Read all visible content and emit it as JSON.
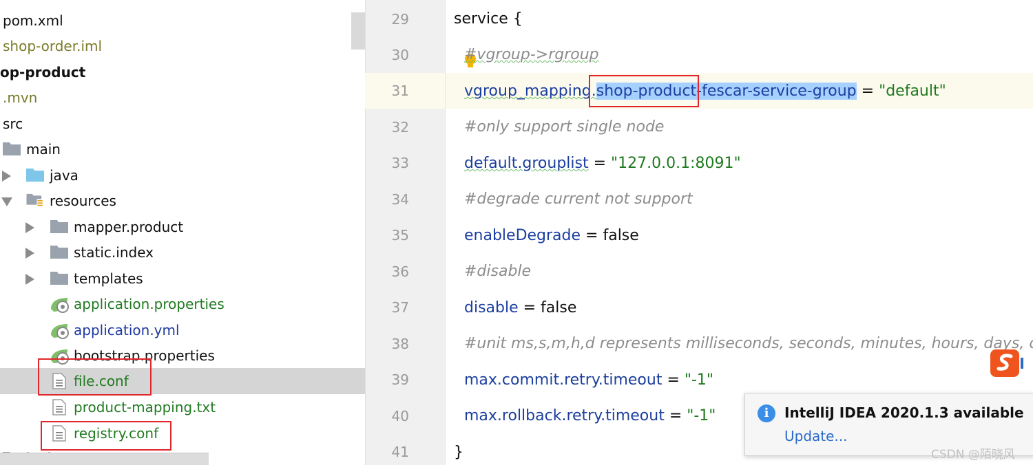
{
  "project_tree": {
    "items": [
      {
        "label": "pom.xml"
      },
      {
        "label": "shop-order.iml"
      },
      {
        "label": "op-product"
      },
      {
        "label": ".mvn"
      },
      {
        "label": "src"
      },
      {
        "label": "main"
      },
      {
        "label": "java"
      },
      {
        "label": "resources"
      },
      {
        "label": "mapper.product"
      },
      {
        "label": "static.index"
      },
      {
        "label": "templates"
      },
      {
        "label": "application.properties"
      },
      {
        "label": "application.yml"
      },
      {
        "label": "bootstrap.properties"
      },
      {
        "label": "file.conf"
      },
      {
        "label": "product-mapping.txt"
      },
      {
        "label": "registry.conf"
      },
      {
        "label": "test"
      }
    ],
    "selected": "file.conf"
  },
  "editor": {
    "line_numbers": [
      "29",
      "30",
      "31",
      "32",
      "33",
      "34",
      "35",
      "36",
      "37",
      "38",
      "39",
      "40",
      "41"
    ],
    "lines": {
      "l29": "service {",
      "l30": "#vgroup->rgroup",
      "l31_key_prefix": "vgroup_mapping.",
      "l31_highlight": "shop-product-",
      "l31_key_rest": "fescar-service-group",
      "l31_eq": " = ",
      "l31_value": "\"default\"",
      "l32": "#only support single node",
      "l33_key": "default.grouplist",
      "l33_eq": " = ",
      "l33_value": "\"127.0.0.1:8091\"",
      "l34": "#degrade current not support",
      "l35_key": "enableDegrade",
      "l35_eq": " = false",
      "l36": "#disable",
      "l37_key": "disable",
      "l37_eq": " = false",
      "l38": "#unit ms,s,m,h,d represents milliseconds, seconds, minutes, hours, days, d",
      "l39_key": "max.commit.retry.timeout",
      "l39_eq": " = ",
      "l39_value": "\"-1\"",
      "l40_key": "max.rollback.retry.timeout",
      "l40_eq": " = ",
      "l40_value": "\"-1\"",
      "l41": "}"
    }
  },
  "notification": {
    "title": "IntelliJ IDEA 2020.1.3 available",
    "link": "Update..."
  },
  "watermark": "CSDN @陌晓风",
  "colors": {
    "keyword": "#1c3f9e",
    "string": "#1f7a1f",
    "comment": "#8c8c8c",
    "highlight": "#e0262a",
    "selection": "#a6d0ff"
  }
}
